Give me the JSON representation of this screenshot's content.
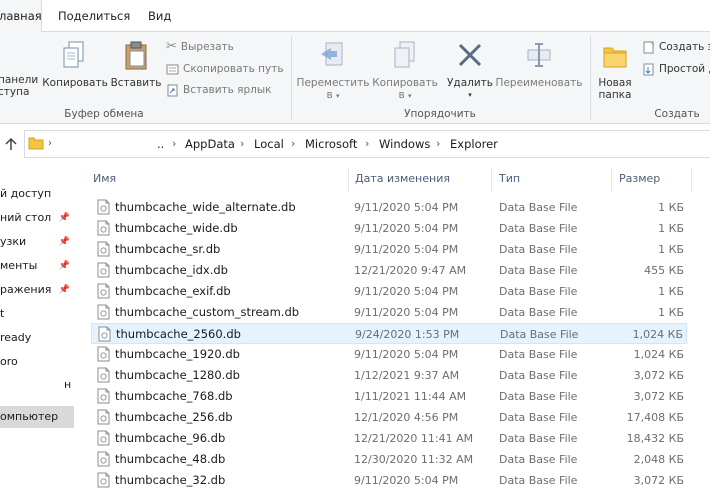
{
  "tabs": [
    {
      "label": "лавная",
      "active": true
    },
    {
      "label": "Поделиться",
      "active": false
    },
    {
      "label": "Вид",
      "active": false
    }
  ],
  "ribbon": {
    "pin_label_1": "панели",
    "pin_label_2": "ступа",
    "copy": "Копировать",
    "paste": "Вставить",
    "cut": "Вырезать",
    "copy_path": "Скопировать путь",
    "paste_shortcut": "Вставить ярлык",
    "clipboard_group": "Буфер обмена",
    "move_to_1": "Переместить",
    "move_to_2": "в",
    "copy_to_1": "Копировать",
    "copy_to_2": "в",
    "delete": "Удалить",
    "rename": "Переименовать",
    "organize_group": "Упорядочить",
    "new_folder_1": "Новая",
    "new_folder_2": "папка",
    "new_item": "Создать э...",
    "easy_access": "Простой д...",
    "create_group": "Создать"
  },
  "address": {
    "ellipsis": "..",
    "crumbs": [
      "AppData",
      "Local",
      "Microsoft",
      "Windows",
      "Explorer"
    ]
  },
  "nav": {
    "items": [
      {
        "label": "й доступ",
        "pinned": false,
        "selected": false
      },
      {
        "label": "ний стол",
        "pinned": true,
        "selected": false
      },
      {
        "label": "узки",
        "pinned": true,
        "selected": false
      },
      {
        "label": "менты",
        "pinned": true,
        "selected": false
      },
      {
        "label": "ражения",
        "pinned": true,
        "selected": false
      },
      {
        "label": "t",
        "pinned": false,
        "selected": false
      },
      {
        "label": "ready",
        "pinned": false,
        "selected": false
      },
      {
        "label": "oro",
        "pinned": false,
        "selected": false
      },
      {
        "label": "",
        "pinned": false,
        "selected": false
      },
      {
        "label": "омпьютер",
        "pinned": false,
        "selected": true
      }
    ],
    "stray_char": "н"
  },
  "columns": {
    "name": "Имя",
    "date": "Дата изменения",
    "type": "Тип",
    "size": "Размер"
  },
  "files": [
    {
      "name": "thumbcache_wide_alternate.db",
      "date": "9/11/2020 5:04 PM",
      "type": "Data Base File",
      "size": "1 КБ"
    },
    {
      "name": "thumbcache_wide.db",
      "date": "9/11/2020 5:04 PM",
      "type": "Data Base File",
      "size": "1 КБ"
    },
    {
      "name": "thumbcache_sr.db",
      "date": "9/11/2020 5:04 PM",
      "type": "Data Base File",
      "size": "1 КБ"
    },
    {
      "name": "thumbcache_idx.db",
      "date": "12/21/2020 9:47 AM",
      "type": "Data Base File",
      "size": "455 КБ"
    },
    {
      "name": "thumbcache_exif.db",
      "date": "9/11/2020 5:04 PM",
      "type": "Data Base File",
      "size": "1 КБ"
    },
    {
      "name": "thumbcache_custom_stream.db",
      "date": "9/11/2020 5:04 PM",
      "type": "Data Base File",
      "size": "1 КБ"
    },
    {
      "name": "thumbcache_2560.db",
      "date": "9/24/2020 1:53 PM",
      "type": "Data Base File",
      "size": "1,024 КБ",
      "highlighted": true
    },
    {
      "name": "thumbcache_1920.db",
      "date": "9/11/2020 5:04 PM",
      "type": "Data Base File",
      "size": "1,024 КБ"
    },
    {
      "name": "thumbcache_1280.db",
      "date": "1/12/2021 9:37 AM",
      "type": "Data Base File",
      "size": "3,072 КБ"
    },
    {
      "name": "thumbcache_768.db",
      "date": "1/11/2021 11:44 AM",
      "type": "Data Base File",
      "size": "3,072 КБ"
    },
    {
      "name": "thumbcache_256.db",
      "date": "12/1/2020 4:56 PM",
      "type": "Data Base File",
      "size": "17,408 КБ"
    },
    {
      "name": "thumbcache_96.db",
      "date": "12/21/2020 11:41 AM",
      "type": "Data Base File",
      "size": "18,432 КБ"
    },
    {
      "name": "thumbcache_48.db",
      "date": "12/30/2020 11:32 AM",
      "type": "Data Base File",
      "size": "2,048 КБ"
    },
    {
      "name": "thumbcache_32.db",
      "date": "9/11/2020 5:04 PM",
      "type": "Data Base File",
      "size": "3,072 КБ"
    }
  ],
  "colors": {
    "accent_hover": "#e5f3ff",
    "ribbon_bg": "#f5f6f7",
    "folder_yellow": "#f4c542"
  }
}
